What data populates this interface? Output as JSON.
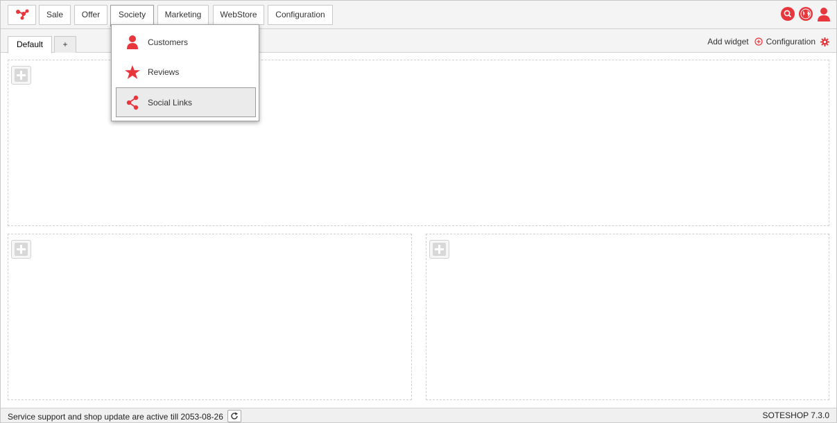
{
  "nav": {
    "logo_icon": "share-network-logo-icon",
    "items": [
      {
        "label": "Sale"
      },
      {
        "label": "Offer"
      },
      {
        "label": "Society",
        "active": true
      },
      {
        "label": "Marketing"
      },
      {
        "label": "WebStore"
      },
      {
        "label": "Configuration"
      }
    ],
    "right_icons": [
      "search-icon",
      "globe-icon",
      "user-icon"
    ],
    "accent_color": "#e8363d"
  },
  "society_menu": {
    "items": [
      {
        "label": "Customers",
        "icon": "user-icon"
      },
      {
        "label": "Reviews",
        "icon": "star-icon"
      },
      {
        "label": "Social Links",
        "icon": "share-icon",
        "highlighted": true
      }
    ]
  },
  "tabs": {
    "items": [
      {
        "label": "Default",
        "active": true
      },
      {
        "label": "+"
      }
    ],
    "add_widget_label": "Add widget",
    "configuration_label": "Configuration"
  },
  "footer": {
    "status_text": "Service support and shop update are active till 2053-08-26",
    "version": "SOTESHOP 7.3.0"
  }
}
